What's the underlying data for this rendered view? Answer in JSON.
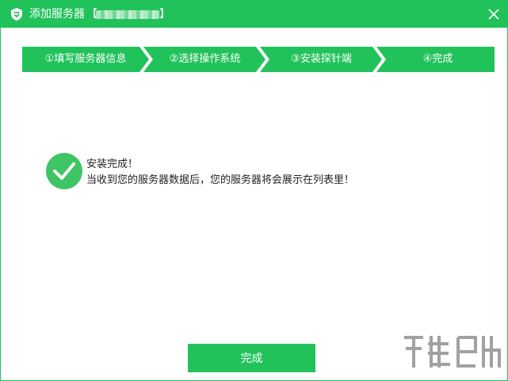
{
  "window": {
    "title": "添加服务器",
    "bracket_open": "【",
    "bracket_close": "】"
  },
  "steps": [
    {
      "label": "①填写服务器信息"
    },
    {
      "label": "②选择操作系统"
    },
    {
      "label": "③安装探针端"
    },
    {
      "label": "④完成"
    }
  ],
  "status": {
    "title": "安装完成！",
    "message": "当收到您的服务器数据后，您的服务器将会展示在列表里！"
  },
  "buttons": {
    "finish_label": "完成"
  },
  "colors": {
    "accent": "#22c25b",
    "text": "#222222"
  },
  "icons": {
    "logo": "shield-logo-icon",
    "close": "close-icon",
    "success": "check-circle-icon"
  }
}
